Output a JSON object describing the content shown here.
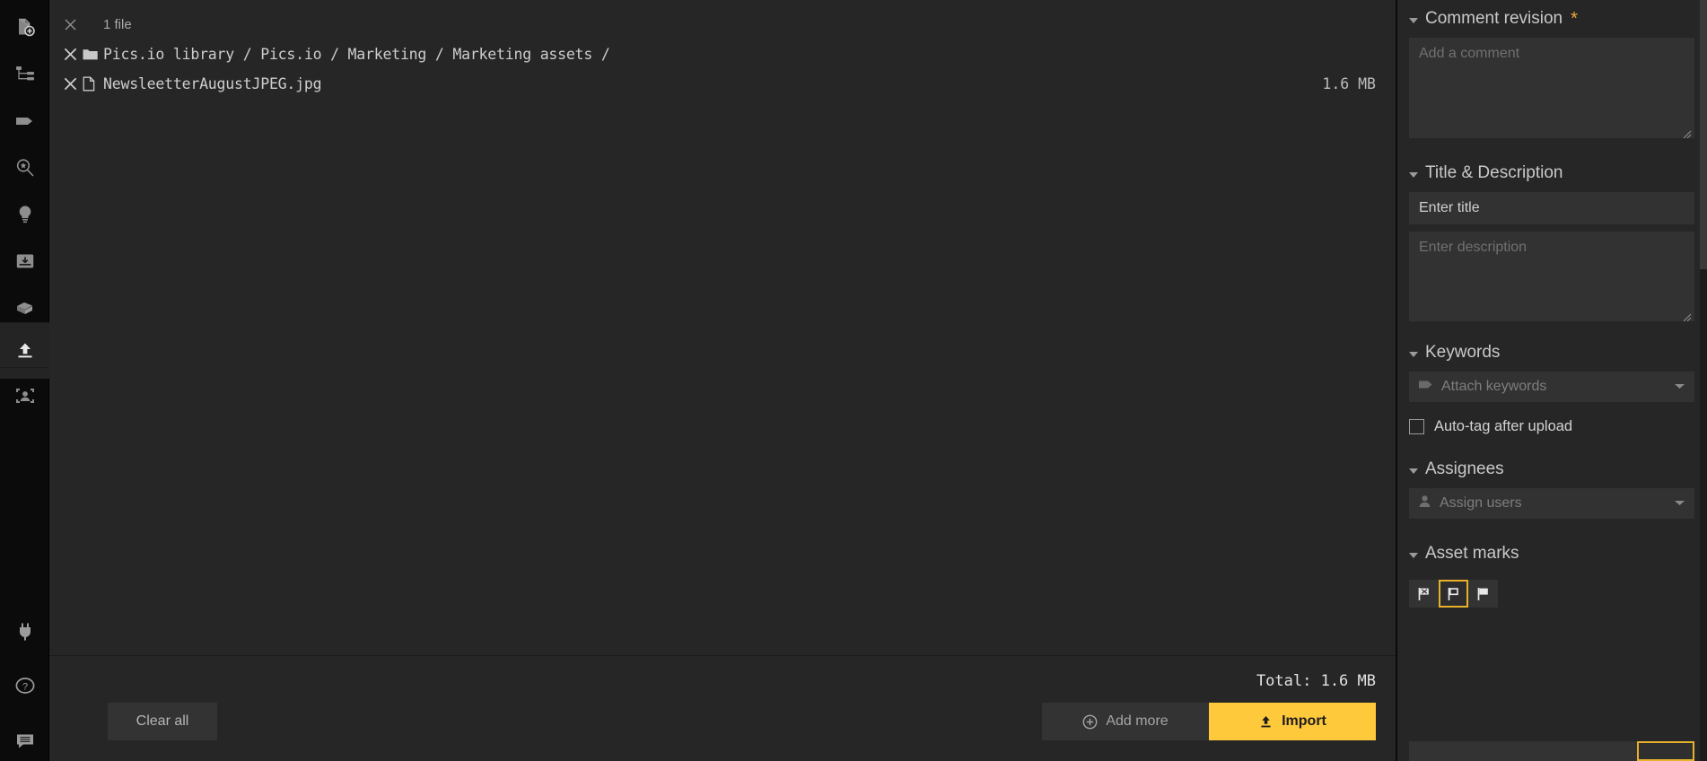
{
  "rail": {
    "items": [
      {
        "name": "new-asset-icon",
        "label": "New asset"
      },
      {
        "name": "tree-icon",
        "label": "Collections tree"
      },
      {
        "name": "keyword-tag-icon",
        "label": "Keywords"
      },
      {
        "name": "saved-search-icon",
        "label": "Saved searches"
      },
      {
        "name": "lightbulb-icon",
        "label": "Lightboards"
      },
      {
        "name": "inbox-icon",
        "label": "Inbox"
      },
      {
        "name": "archive-icon",
        "label": "Archive"
      },
      {
        "name": "upload-icon",
        "label": "Upload",
        "active": true
      },
      {
        "name": "face-recognition-icon",
        "label": "Face recognition"
      }
    ],
    "bottom_items": [
      {
        "name": "plug-icon",
        "label": "Integrations"
      },
      {
        "name": "help-icon",
        "label": "Help"
      },
      {
        "name": "feedback-icon",
        "label": "Feedback"
      }
    ]
  },
  "upload": {
    "file_count_label": "1 file",
    "breadcrumb": "Pics.io library / Pics.io / Marketing / Marketing assets /",
    "file_name": "NewsleetterAugustJPEG.jpg",
    "file_size": "1.6 MB",
    "total_label": "Total: 1.6 MB",
    "clear_all_label": "Clear all",
    "add_more_label": "Add more",
    "import_label": "Import"
  },
  "panel": {
    "comment": {
      "title": "Comment revision",
      "required_mark": "*",
      "placeholder": "Add a comment",
      "value": ""
    },
    "title_description": {
      "title": "Title & Description",
      "title_value": "Enter title",
      "title_placeholder": "Enter title",
      "description_value": "",
      "description_placeholder": "Enter description"
    },
    "keywords": {
      "title": "Keywords",
      "select_placeholder": "Attach keywords",
      "autotag_label": "Auto-tag after upload",
      "autotag_checked": false
    },
    "assignees": {
      "title": "Assignees",
      "select_placeholder": "Assign users"
    },
    "asset_marks": {
      "title": "Asset marks",
      "options": [
        {
          "name": "mark-rejected-icon",
          "label": "Rejected",
          "selected": false
        },
        {
          "name": "mark-none-icon",
          "label": "No mark",
          "selected": true
        },
        {
          "name": "mark-approved-icon",
          "label": "Approved",
          "selected": false
        }
      ]
    }
  },
  "colors": {
    "accent": "#ffc93c",
    "accent_border": "#e8b12c",
    "panel_bg": "#262626",
    "field_bg": "#323232",
    "rail_bg": "#0b0b0b"
  }
}
